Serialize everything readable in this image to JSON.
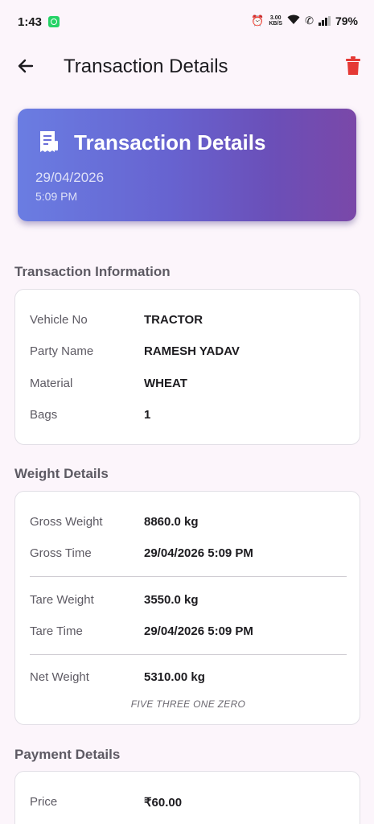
{
  "status_bar": {
    "time": "1:43",
    "speed_value": "3.00",
    "speed_unit": "KB/S",
    "battery": "79%"
  },
  "app_bar": {
    "title": "Transaction Details",
    "back_icon": "arrow-back-icon",
    "delete_icon": "trash-icon",
    "delete_color": "#e53935"
  },
  "header": {
    "title": "Transaction Details",
    "date": "29/04/2026",
    "time": "5:09 PM",
    "icon": "receipt-icon"
  },
  "transaction_info": {
    "title": "Transaction Information",
    "rows": [
      {
        "label": "Vehicle No",
        "value": "TRACTOR"
      },
      {
        "label": "Party Name",
        "value": "RAMESH YADAV"
      },
      {
        "label": "Material",
        "value": "WHEAT"
      },
      {
        "label": "Bags",
        "value": "1"
      }
    ]
  },
  "weight_details": {
    "title": "Weight Details",
    "gross_weight": {
      "label": "Gross Weight",
      "value": "8860.0 kg"
    },
    "gross_time": {
      "label": "Gross Time",
      "value": "29/04/2026 5:09 PM"
    },
    "tare_weight": {
      "label": "Tare Weight",
      "value": "3550.0 kg"
    },
    "tare_time": {
      "label": "Tare Time",
      "value": "29/04/2026 5:09 PM"
    },
    "net_weight": {
      "label": "Net Weight",
      "value": "5310.00 kg"
    },
    "in_words": "FIVE THREE ONE ZERO"
  },
  "payment_details": {
    "title": "Payment Details",
    "price": {
      "label": "Price",
      "value": "₹60.00"
    }
  },
  "colors": {
    "background": "#fcf5fb",
    "header_gradient_start": "#6a7de2",
    "header_gradient_end": "#7a48a8"
  }
}
